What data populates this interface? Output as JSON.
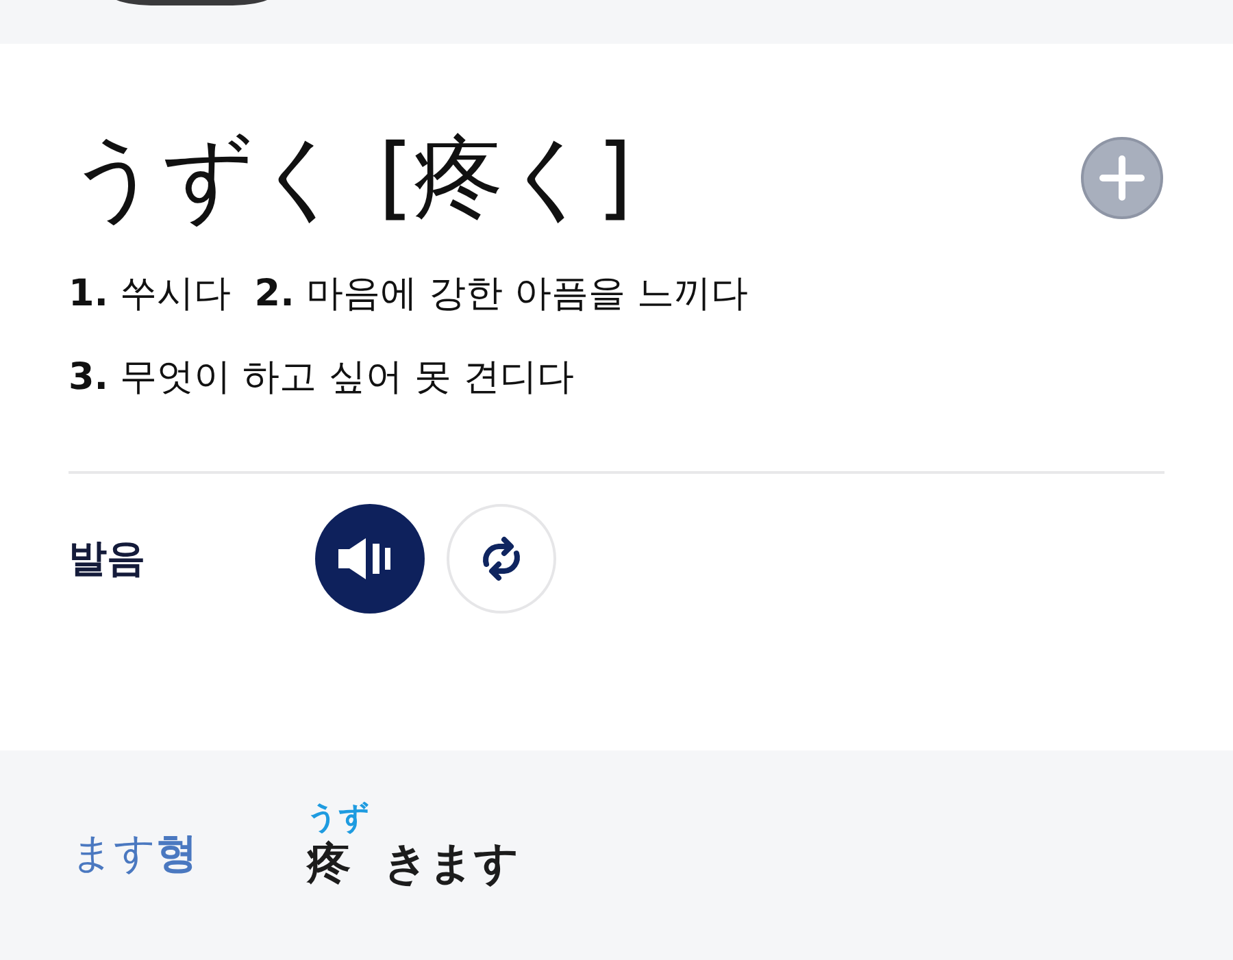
{
  "entry": {
    "word": "うずく",
    "kanji": "[疼く]"
  },
  "definitions": [
    "**1.** 쑤시다  **2.** 마음에 강한 아픔을 느끼다",
    "**3.** 무엇이 하고 싶어 못 견디다"
  ],
  "pronunciation": {
    "label": "발음"
  },
  "conjugation": {
    "label": "ます**형**",
    "kanji": "疼",
    "reading": "うず",
    "okurigana": "きます"
  }
}
